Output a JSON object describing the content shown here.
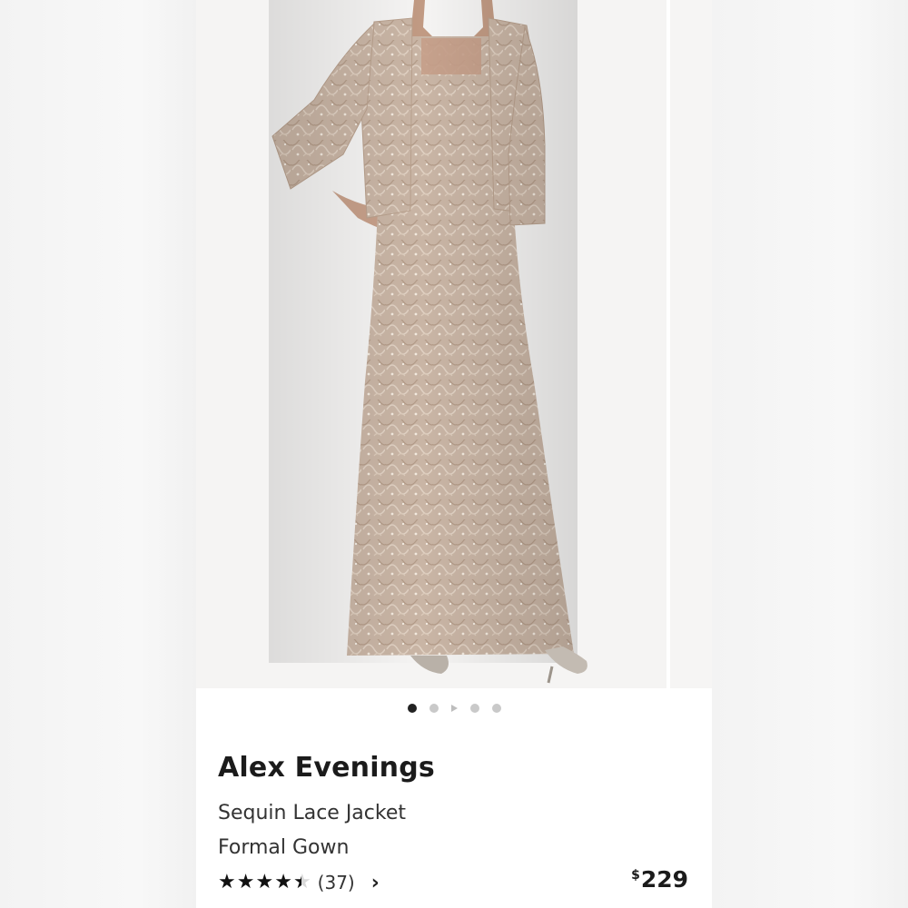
{
  "product": {
    "brand": "Alex Evenings",
    "name_line1": "Sequin Lace Jacket",
    "name_line2": "Formal Gown",
    "rating_count": "(37)",
    "rating_value": 4.5,
    "price_currency": "$",
    "price_amount": "229"
  },
  "gallery": {
    "image_description": "model wearing champagne sequin lace jacket and floor-length gown",
    "dot_count": 5,
    "active_index": 0
  },
  "colors": {
    "dress": "#c9b4a4",
    "star": "#111111",
    "inactive_dot": "#c9c9c9"
  }
}
